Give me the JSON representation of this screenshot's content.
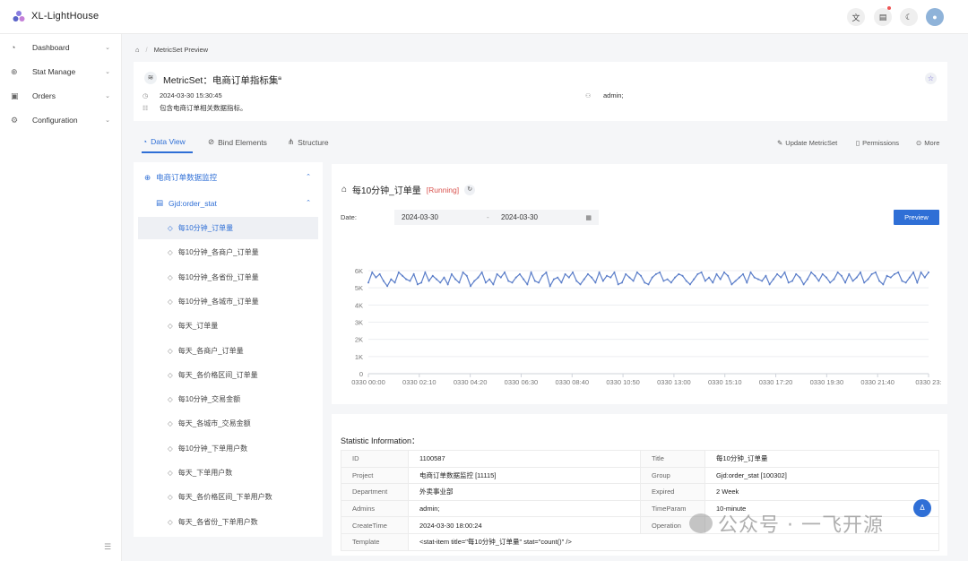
{
  "app": {
    "title": "XL-LightHouse"
  },
  "sidebar": {
    "items": [
      {
        "label": "Dashboard",
        "icon": "dashboard-icon"
      },
      {
        "label": "Stat Manage",
        "icon": "stat-manage-icon"
      },
      {
        "label": "Orders",
        "icon": "orders-icon"
      },
      {
        "label": "Configuration",
        "icon": "gear-icon"
      }
    ]
  },
  "breadcrumb": {
    "current": "MetricSet Preview"
  },
  "metricset": {
    "title": "MetricSet：电商订单指标集",
    "created": "2024-03-30 15:30:45",
    "description": "包含电商订单相关数据指标。",
    "admin": "admin;"
  },
  "tabs": {
    "data_view": "Data View",
    "bind_elements": "Bind Elements",
    "structure": "Structure",
    "update": "Update MetricSet",
    "permissions": "Permissions",
    "more": "More"
  },
  "tree": {
    "root": "电商订单数据监控",
    "group": "Gjd:order_stat",
    "items": [
      "每10分钟_订单量",
      "每10分钟_各商户_订单量",
      "每10分钟_各省份_订单量",
      "每10分钟_各城市_订单量",
      "每天_订单量",
      "每天_各商户_订单量",
      "每天_各价格区间_订单量",
      "每10分钟_交易金额",
      "每天_各城市_交易金额",
      "每10分钟_下单用户数",
      "每天_下单用户数",
      "每天_各价格区间_下单用户数",
      "每天_各省份_下单用户数"
    ],
    "selected_index": 0
  },
  "chart_panel": {
    "title": "每10分钟_订单量",
    "status": "[Running]",
    "date_label": "Date:",
    "date_start": "2024-03-30",
    "date_sep": "-",
    "date_end": "2024-03-30",
    "preview_label": "Preview"
  },
  "chart_data": {
    "type": "line",
    "ylim": [
      0,
      6000
    ],
    "yticks": [
      "0",
      "1K",
      "2K",
      "3K",
      "4K",
      "5K",
      "6K"
    ],
    "xticks": [
      "0330 00:00",
      "0330 02:10",
      "0330 04:20",
      "0330 06:30",
      "0330 08:40",
      "0330 10:50",
      "0330 13:00",
      "0330 15:10",
      "0330 17:20",
      "0330 19:30",
      "0330 21:40",
      "0330 23:"
    ],
    "color": "#5b7ec9",
    "values": [
      5300,
      5900,
      5600,
      5800,
      5400,
      5100,
      5500,
      5300,
      5900,
      5700,
      5500,
      5400,
      5800,
      5200,
      5300,
      5900,
      5400,
      5700,
      5500,
      5300,
      5600,
      5200,
      5800,
      5500,
      5300,
      5900,
      5700,
      5100,
      5400,
      5600,
      5900,
      5300,
      5500,
      5200,
      5800,
      5600,
      5900,
      5400,
      5300,
      5600,
      5800,
      5500,
      5200,
      5900,
      5400,
      5300,
      5700,
      5900,
      5100,
      5500,
      5600,
      5300,
      5800,
      5600,
      5900,
      5400,
      5200,
      5500,
      5800,
      5600,
      5300,
      5900,
      5400,
      5700,
      5600,
      5900,
      5200,
      5300,
      5800,
      5600,
      5400,
      5900,
      5700,
      5300,
      5200,
      5600,
      5800,
      5900,
      5400,
      5500,
      5300,
      5600,
      5800,
      5700,
      5400,
      5200,
      5500,
      5800,
      5900,
      5400,
      5600,
      5300,
      5800,
      5500,
      5900,
      5700,
      5200,
      5400,
      5600,
      5800,
      5300,
      5900,
      5600,
      5500,
      5400,
      5700,
      5200,
      5500,
      5800,
      5600,
      5900,
      5300,
      5400,
      5800,
      5600,
      5200,
      5500,
      5900,
      5700,
      5400,
      5800,
      5600,
      5300,
      5500,
      5900,
      5700,
      5300,
      5800,
      5400,
      5600,
      5900,
      5300,
      5500,
      5800,
      5900,
      5400,
      5200,
      5700,
      5600,
      5800,
      5900,
      5400,
      5300,
      5600,
      5900,
      5300,
      5900,
      5600,
      5900
    ]
  },
  "stat": {
    "title": "Statistic Information：",
    "rows": [
      {
        "k1": "ID",
        "v1": "1100587",
        "k2": "Title",
        "v2": "每10分钟_订单量"
      },
      {
        "k1": "Project",
        "v1": "电商订单数据监控 [11115]",
        "k2": "Group",
        "v2": "Gjd:order_stat [100302]"
      },
      {
        "k1": "Department",
        "v1": "外卖事业部",
        "k2": "Expired",
        "v2": "2 Week"
      },
      {
        "k1": "Admins",
        "v1": "admin;",
        "k2": "TimeParam",
        "v2": "10-minute"
      },
      {
        "k1": "CreateTime",
        "v1": "2024-03-30 18:00:24",
        "k2": "Operation",
        "v2": ""
      }
    ],
    "template_key": "Template",
    "template_value": "<stat-item title=\"每10分钟_订单量\" stat=\"count()\" />"
  },
  "watermark": "公众号 · 一飞开源"
}
